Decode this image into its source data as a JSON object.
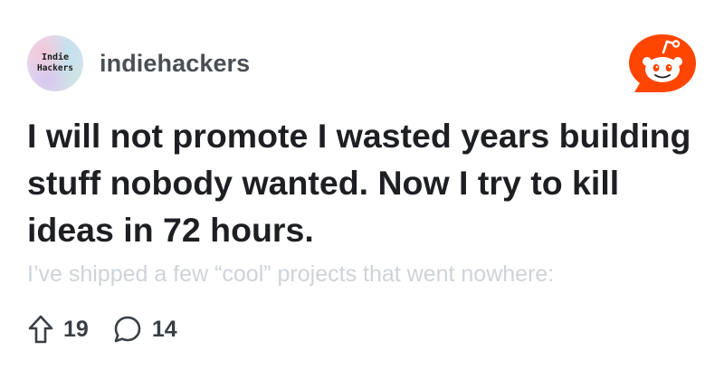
{
  "post": {
    "community": {
      "name": "indiehackers",
      "avatar_text_line1": "Indie",
      "avatar_text_line2": "Hackers"
    },
    "title": "I will not promote I wasted years building stuff nobody wanted. Now I try to kill ideas in 72 hours.",
    "preview": "I’ve shipped a few “cool” projects that went nowhere:",
    "stats": {
      "upvotes": "19",
      "comments": "14"
    }
  },
  "icons": {
    "brand": "reddit-logo-icon",
    "upvote": "upvote-arrow-icon",
    "comment": "comment-bubble-icon"
  },
  "colors": {
    "brand": "#ff4500",
    "title": "#1e1f22",
    "community": "#4a4f55",
    "preview": "#cfd3d7",
    "stats": "#3a3f45"
  }
}
